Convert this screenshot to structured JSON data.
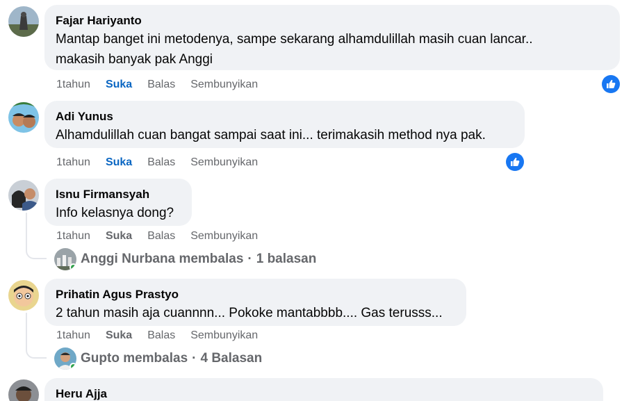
{
  "comments": [
    {
      "author": "Fajar Hariyanto",
      "text_lines": [
        "Mantap banget ini metodenya, sampe sekarang alhamdulillah masih cuan lancar..",
        "makasih banyak pak Anggi"
      ],
      "time": "1tahun",
      "like": "Suka",
      "reply": "Balas",
      "hide": "Sembunyikan",
      "liked": true,
      "reaction_icon": "thumbs-up-icon"
    },
    {
      "author": "Adi Yunus",
      "text_lines": [
        "Alhamdulillah cuan bangat sampai saat ini... terimakasih method nya pak."
      ],
      "time": "1tahun",
      "like": "Suka",
      "reply": "Balas",
      "hide": "Sembunyikan",
      "liked": true,
      "reaction_icon": "thumbs-up-icon"
    },
    {
      "author": "Isnu Firmansyah",
      "text_lines": [
        "Info kelasnya dong?"
      ],
      "time": "1tahun",
      "like": "Suka",
      "reply": "Balas",
      "hide": "Sembunyikan",
      "liked": false,
      "replies_summary": {
        "name": "Anggi Nurbana membalas",
        "count": "1 balasan"
      }
    },
    {
      "author": "Prihatin Agus Prastyo",
      "text_lines": [
        "2 tahun masih aja cuannnn... Pokoke mantabbbb.... Gas terusss..."
      ],
      "time": "1tahun",
      "like": "Suka",
      "reply": "Balas",
      "hide": "Sembunyikan",
      "liked": false,
      "replies_summary": {
        "name": "Gupto membalas",
        "count": "4 Balasan"
      }
    },
    {
      "author": "Heru Ajja",
      "text_lines": []
    }
  ],
  "colors": {
    "bubble": "#f0f2f5",
    "like_active": "#0a66c2",
    "meta": "#65676b",
    "reaction": "#1877f2",
    "online": "#31a24c"
  }
}
